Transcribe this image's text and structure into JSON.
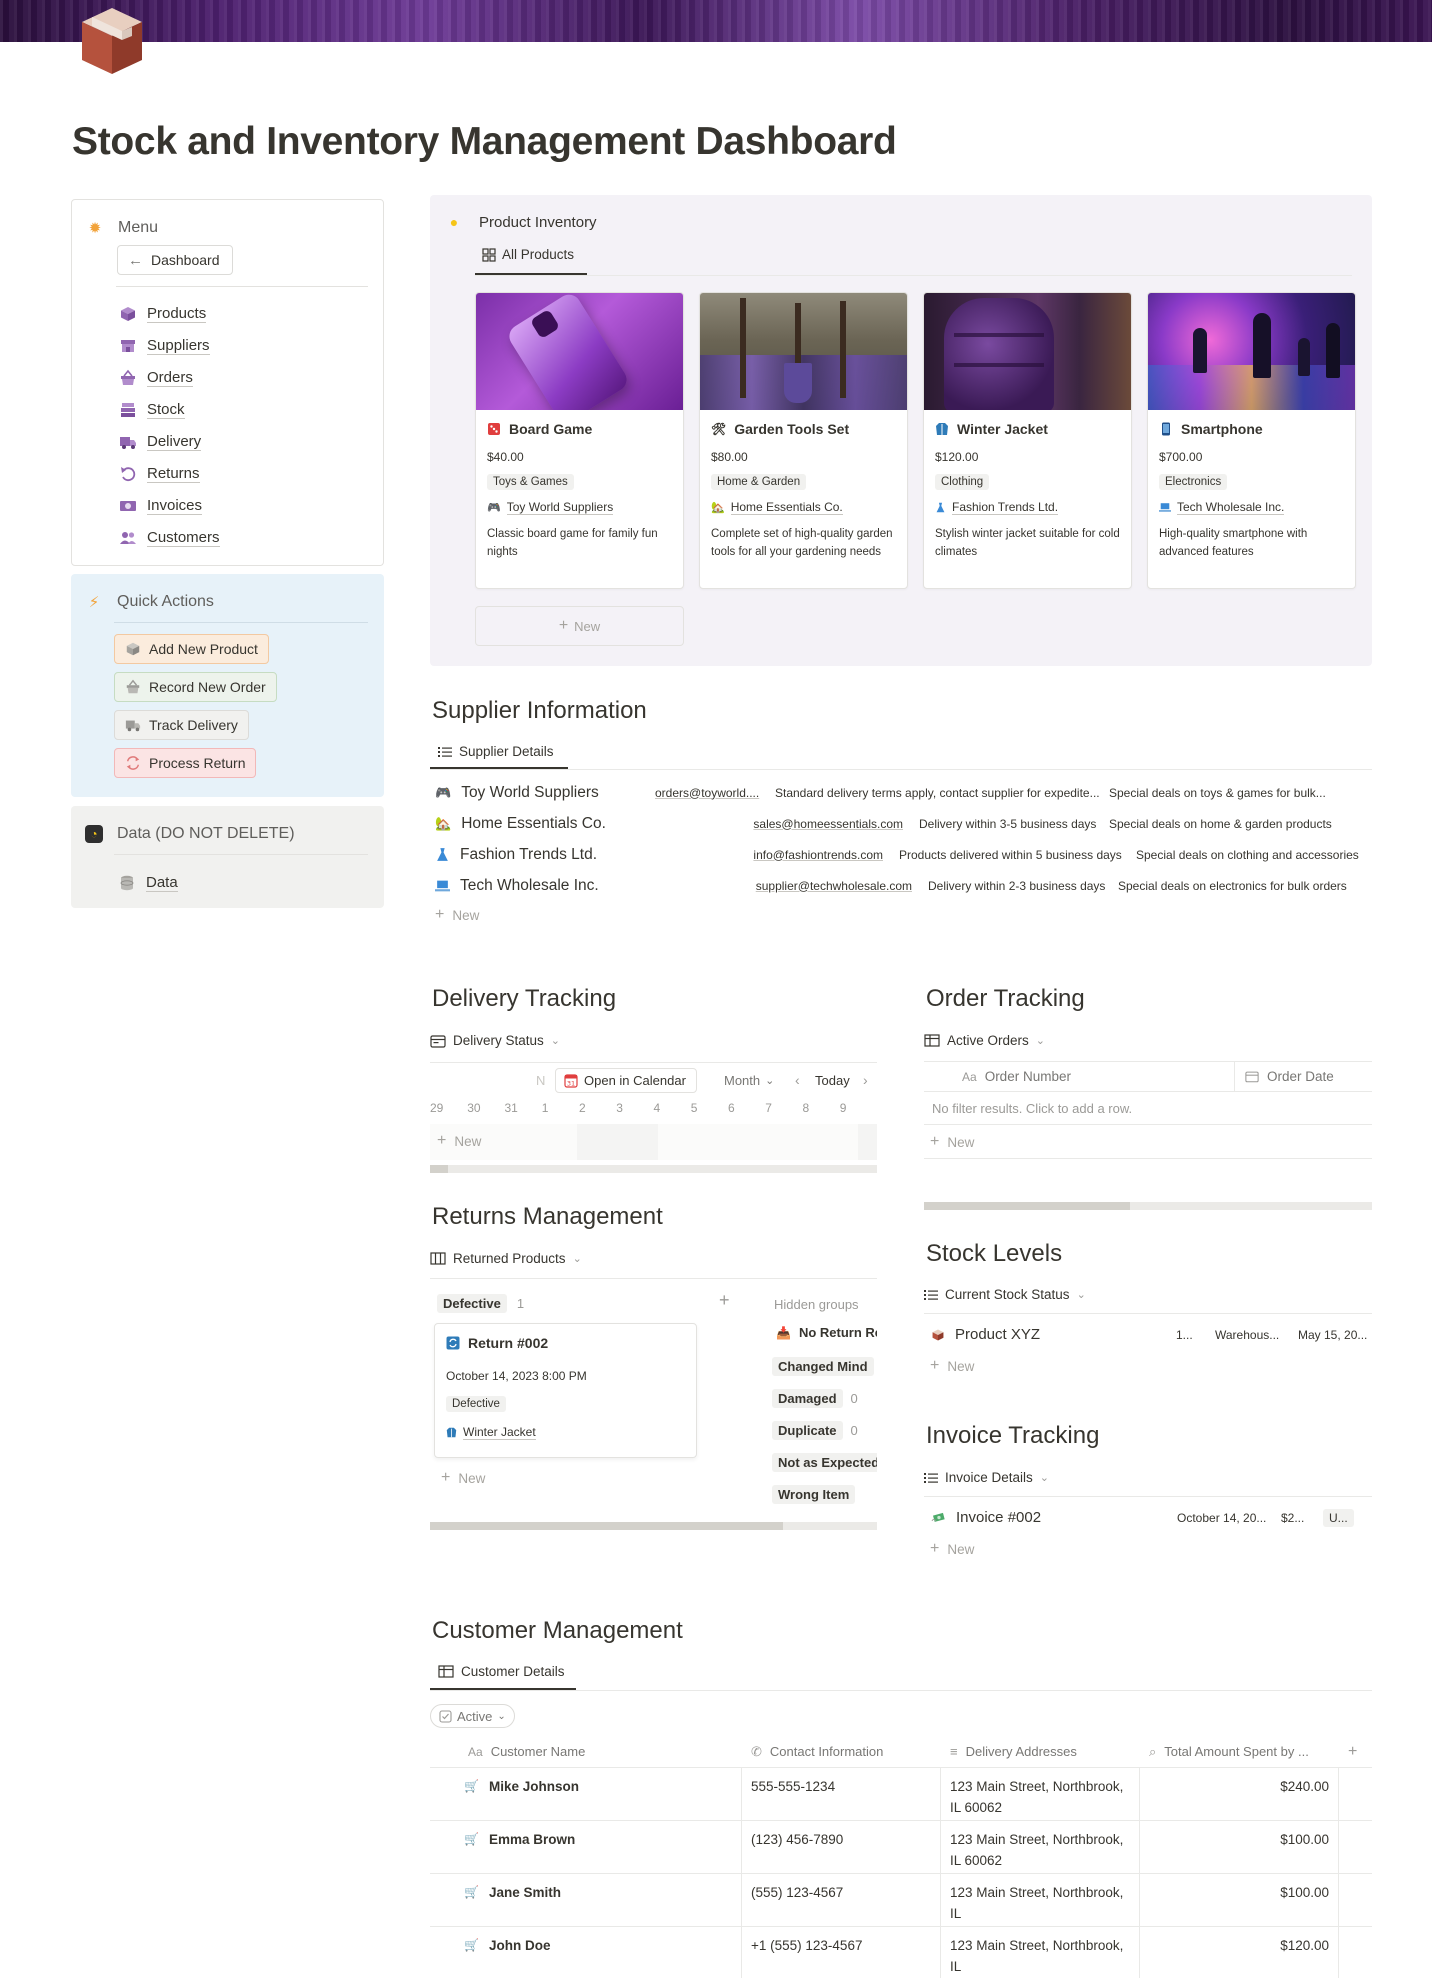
{
  "page": {
    "title": "Stock and Inventory Management Dashboard"
  },
  "sidebar": {
    "menu_title": "Menu",
    "dashboard_button": "Dashboard",
    "items": [
      {
        "label": "Products",
        "icon": "box-icon",
        "color": "#9065b0"
      },
      {
        "label": "Suppliers",
        "icon": "store-icon",
        "color": "#9065b0"
      },
      {
        "label": "Orders",
        "icon": "basket-icon",
        "color": "#9065b0"
      },
      {
        "label": "Stock",
        "icon": "stack-icon",
        "color": "#9065b0"
      },
      {
        "label": "Delivery",
        "icon": "truck-icon",
        "color": "#9065b0"
      },
      {
        "label": "Returns",
        "icon": "return-arrow-icon",
        "color": "#9065b0"
      },
      {
        "label": "Invoices",
        "icon": "money-icon",
        "color": "#9065b0"
      },
      {
        "label": "Customers",
        "icon": "people-icon",
        "color": "#9065b0"
      }
    ],
    "quick_actions": {
      "title": "Quick Actions",
      "buttons": [
        {
          "label": "Add New Product",
          "bg": "#fbecdd",
          "border": "#f3c9a1"
        },
        {
          "label": "Record New Order",
          "bg": "#edf3ec",
          "border": "#c6dcc2"
        },
        {
          "label": "Track Delivery",
          "bg": "#f1f1ef",
          "border": "#dcdbd8"
        },
        {
          "label": "Process Return",
          "bg": "#fbe4e4",
          "border": "#f2b8b8"
        }
      ]
    },
    "data_section": {
      "title": "Data (DO NOT DELETE)",
      "item": "Data"
    }
  },
  "inventory": {
    "title": "Product Inventory",
    "view_tab": "All Products",
    "new_label": "New",
    "cards": [
      {
        "name": "Board Game",
        "price": "$40.00",
        "category": "Toys & Games",
        "supplier": "Toy World Suppliers",
        "description": "Classic board game for family fun nights"
      },
      {
        "name": "Garden Tools Set",
        "price": "$80.00",
        "category": "Home & Garden",
        "supplier": "Home Essentials Co.",
        "description": "Complete set of high-quality garden tools for all your gardening needs"
      },
      {
        "name": "Winter Jacket",
        "price": "$120.00",
        "category": "Clothing",
        "supplier": "Fashion Trends Ltd.",
        "description": "Stylish winter jacket suitable for cold climates"
      },
      {
        "name": "Smartphone",
        "price": "$700.00",
        "category": "Electronics",
        "supplier": "Tech Wholesale Inc.",
        "description": "High-quality smartphone with advanced features"
      }
    ]
  },
  "suppliers": {
    "title": "Supplier Information",
    "view_tab": "Supplier Details",
    "new_label": "New",
    "rows": [
      {
        "name": "Toy World Suppliers",
        "email": "orders@toyworld....",
        "terms": "Standard delivery terms apply, contact supplier for expedite...",
        "deals": "Special deals on toys & games for bulk..."
      },
      {
        "name": "Home Essentials Co.",
        "email": "sales@homeessentials.com",
        "terms": "Delivery within 3-5 business days",
        "deals": "Special deals on home & garden products"
      },
      {
        "name": "Fashion Trends Ltd.",
        "email": "info@fashiontrends.com",
        "terms": "Products delivered within 5 business days",
        "deals": "Special deals on clothing and accessories"
      },
      {
        "name": "Tech Wholesale Inc.",
        "email": "supplier@techwholesale.com",
        "terms": "Delivery within 2-3 business days",
        "deals": "Special deals on electronics for bulk orders"
      }
    ]
  },
  "delivery": {
    "title": "Delivery Tracking",
    "view_tab": "Delivery Status",
    "n_label": "N",
    "open_calendar": "Open in Calendar",
    "month": "Month",
    "today": "Today",
    "days": [
      "29",
      "30",
      "31",
      "1",
      "2",
      "3",
      "4",
      "5",
      "6",
      "7",
      "8",
      "9"
    ],
    "new_label": "New",
    "scroll_fraction": 0.04
  },
  "orders": {
    "title": "Order Tracking",
    "view_tab": "Active Orders",
    "col_order_number": "Order Number",
    "col_order_date": "Order Date",
    "empty_text": "No filter results. Click to add a row.",
    "new_label": "New",
    "scroll_fraction": 0.46
  },
  "returns": {
    "title": "Returns Management",
    "view_tab": "Returned Products",
    "group_label": "Defective",
    "group_count": "1",
    "card_title": "Return #002",
    "card_date": "October 14, 2023 8:00 PM",
    "card_tag": "Defective",
    "card_product": "Winter Jacket",
    "new_label": "New",
    "hidden_groups_label": "Hidden groups",
    "hidden_groups": [
      {
        "label": "No Return Re",
        "count": ""
      },
      {
        "label": "Changed Mind",
        "count": ""
      },
      {
        "label": "Damaged",
        "count": "0"
      },
      {
        "label": "Duplicate",
        "count": "0"
      },
      {
        "label": "Not as Expected",
        "count": ""
      },
      {
        "label": "Wrong Item",
        "count": ""
      }
    ],
    "scroll_fraction": 0.79
  },
  "stock": {
    "title": "Stock Levels",
    "view_tab": "Current Stock Status",
    "row": {
      "name": "Product XYZ",
      "qty": "1...",
      "warehouse": "Warehous...",
      "date": "May 15, 20..."
    },
    "new_label": "New"
  },
  "invoices": {
    "title": "Invoice Tracking",
    "view_tab": "Invoice Details",
    "row": {
      "name": "Invoice #002",
      "date": "October 14, 20...",
      "amount": "$2...",
      "status": "U..."
    },
    "new_label": "New"
  },
  "customers": {
    "title": "Customer Management",
    "view_tab": "Customer Details",
    "filter": "Active",
    "columns": [
      "Customer Name",
      "Contact Information",
      "Delivery Addresses",
      "Total Amount Spent by ..."
    ],
    "rows": [
      {
        "name": "Mike Johnson",
        "contact": "555-555-1234",
        "address": "123 Main Street, Northbrook, IL 60062",
        "total": "$240.00"
      },
      {
        "name": "Emma Brown",
        "contact": "(123) 456-7890",
        "address": "123 Main Street, Northbrook, IL 60062",
        "total": "$100.00"
      },
      {
        "name": "Jane Smith",
        "contact": "(555) 123-4567",
        "address": "123 Main Street, Northbrook, IL",
        "total": "$100.00"
      },
      {
        "name": "John Doe",
        "contact": "+1 (555) 123-4567",
        "address": "123 Main Street, Northbrook, IL",
        "total": "$120.00"
      }
    ]
  }
}
